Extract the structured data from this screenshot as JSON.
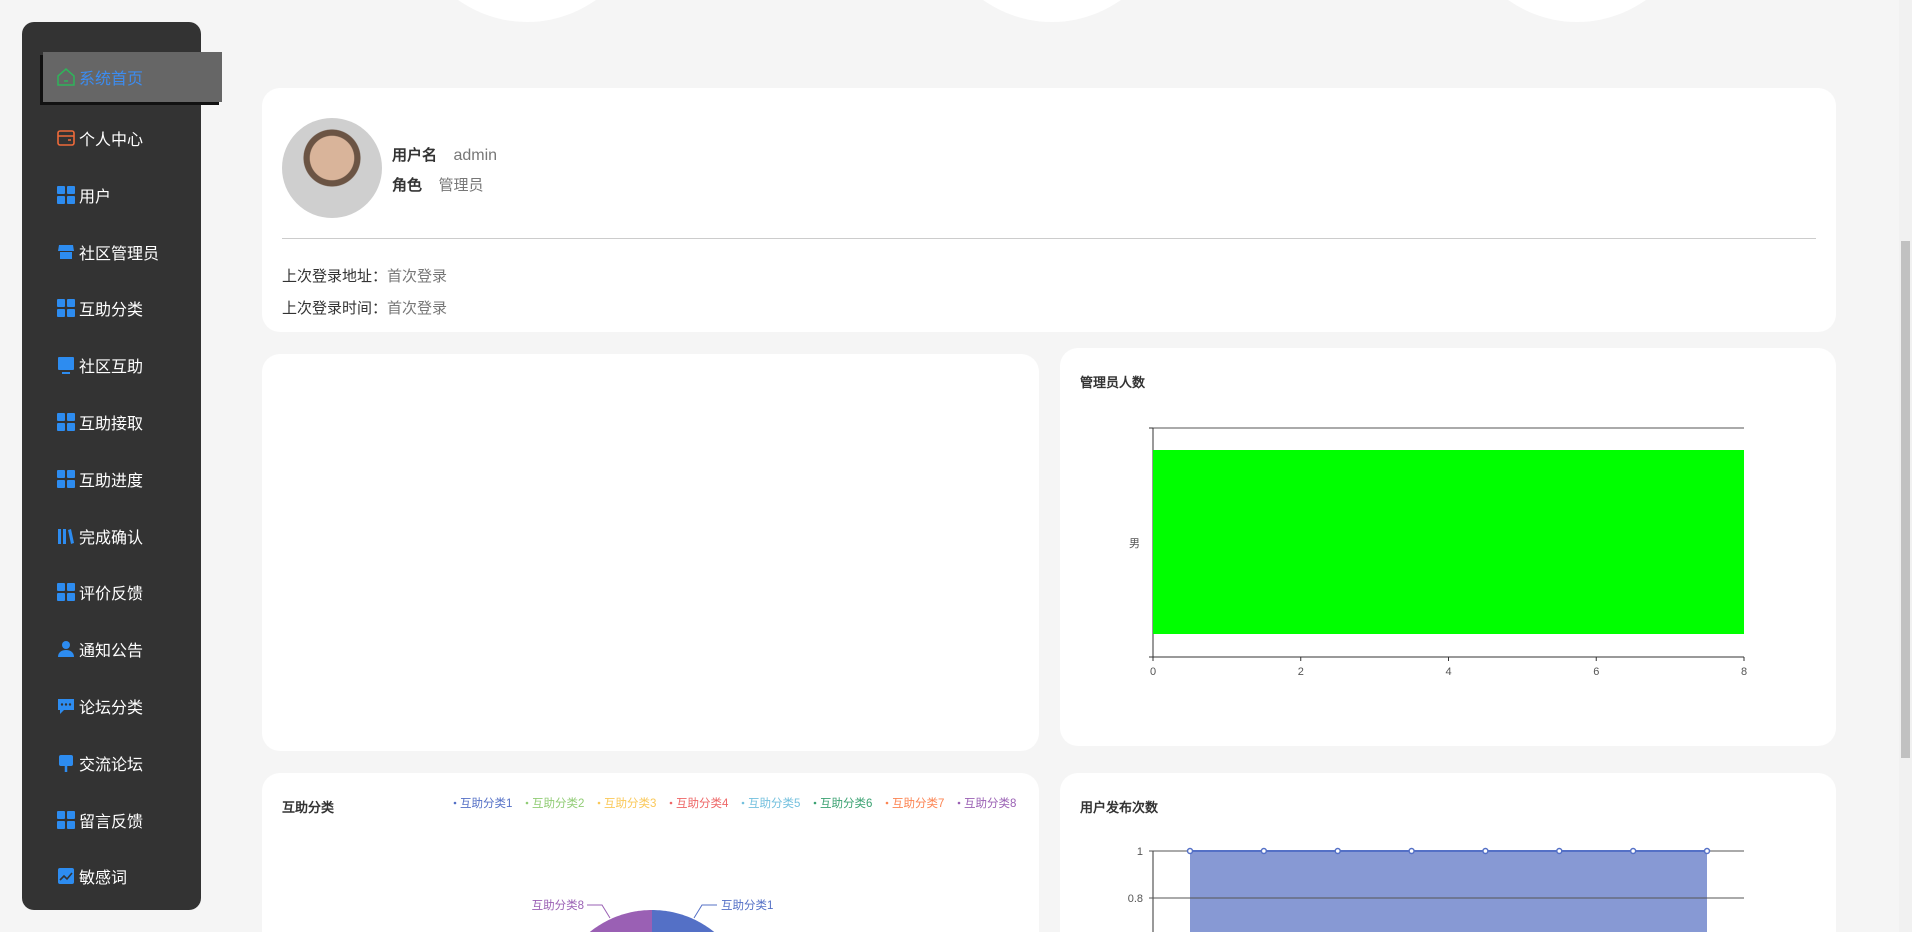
{
  "sidebar": {
    "items": [
      {
        "label": "系统首页",
        "icon": "home-icon"
      },
      {
        "label": "个人中心",
        "icon": "wallet-icon"
      },
      {
        "label": "用户",
        "icon": "grid-icon"
      },
      {
        "label": "社区管理员",
        "icon": "shop-icon"
      },
      {
        "label": "互助分类",
        "icon": "grid-icon"
      },
      {
        "label": "社区互助",
        "icon": "monitor-icon"
      },
      {
        "label": "互助接取",
        "icon": "grid-icon"
      },
      {
        "label": "互助进度",
        "icon": "grid-icon"
      },
      {
        "label": "完成确认",
        "icon": "books-icon"
      },
      {
        "label": "评价反馈",
        "icon": "grid-icon"
      },
      {
        "label": "通知公告",
        "icon": "user-icon"
      },
      {
        "label": "论坛分类",
        "icon": "chat-icon"
      },
      {
        "label": "交流论坛",
        "icon": "pin-icon"
      },
      {
        "label": "留言反馈",
        "icon": "grid-icon"
      },
      {
        "label": "敏感词",
        "icon": "trend-icon"
      }
    ]
  },
  "user": {
    "username_label": "用户名",
    "username": "admin",
    "role_label": "角色",
    "role": "管理员",
    "last_addr_label": "上次登录地址：",
    "last_addr": "首次登录",
    "last_time_label": "上次登录时间：",
    "last_time": "首次登录"
  },
  "colors": {
    "accent": "#3c8cf0",
    "bar": "#00ff00",
    "line": "#5470c6"
  },
  "chart_data": [
    {
      "type": "bar",
      "title": "管理员人数",
      "orientation": "horizontal",
      "categories": [
        "男"
      ],
      "values": [
        8
      ],
      "xlim": [
        0,
        8
      ],
      "xticks": [
        "0",
        "2",
        "4",
        "6",
        "8"
      ]
    },
    {
      "type": "pie",
      "title": "互助分类",
      "legend": [
        "互助分类1",
        "互助分类2",
        "互助分类3",
        "互助分类4",
        "互助分类5",
        "互助分类6",
        "互助分类7",
        "互助分类8"
      ],
      "values": [
        1,
        1,
        1,
        1,
        1,
        1,
        1,
        1
      ],
      "colors": [
        "#5470c6",
        "#91cc75",
        "#fac858",
        "#ee6666",
        "#73c0de",
        "#3ba272",
        "#fc8452",
        "#9a60b4"
      ],
      "legend_position": "top-right"
    },
    {
      "type": "area",
      "title": "用户发布次数",
      "values": [
        1,
        1,
        1,
        1,
        1,
        1,
        1,
        1
      ],
      "yticks": [
        "1",
        "0.8"
      ]
    }
  ]
}
